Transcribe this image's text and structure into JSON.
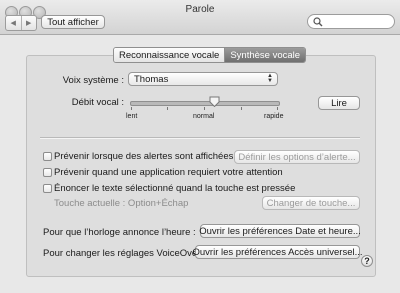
{
  "window": {
    "title": "Parole"
  },
  "toolbar": {
    "back": "◀",
    "forward": "▶",
    "show_all": "Tout afficher",
    "search_placeholder": ""
  },
  "tabs": [
    {
      "label": "Reconnaissance vocale",
      "selected": false
    },
    {
      "label": "Synthèse vocale",
      "selected": true
    }
  ],
  "voice": {
    "label": "Voix système :",
    "value": "Thomas"
  },
  "rate": {
    "label": "Débit vocal :",
    "min_label": "lent",
    "mid_label": "normal",
    "max_label": "rapide",
    "level": 0.57
  },
  "play_button": "Lire",
  "options": {
    "alerts": {
      "label": "Prévenir lorsque des alertes sont affichées",
      "checked": false,
      "button": "Définir les options d’alerte..."
    },
    "attention": {
      "label": "Prévenir quand une application requiert votre attention",
      "checked": false
    },
    "speak_selection": {
      "label": "Énoncer le texte sélectionné quand la touche est pressée",
      "checked": false,
      "current_key": "Touche actuelle : Option+Échap",
      "button": "Changer de touche..."
    }
  },
  "clock": {
    "label": "Pour que l’horloge annonce l’heure :",
    "button": "Ouvrir les préférences Date et heure..."
  },
  "voiceover": {
    "label": "Pour changer les réglages VoiceOver :",
    "button": "Ouvrir les préférences Accès universel..."
  },
  "help": "?",
  "colors": {
    "selected_tab": "#7d7d7d",
    "window_bg": "#e8e8e8"
  }
}
